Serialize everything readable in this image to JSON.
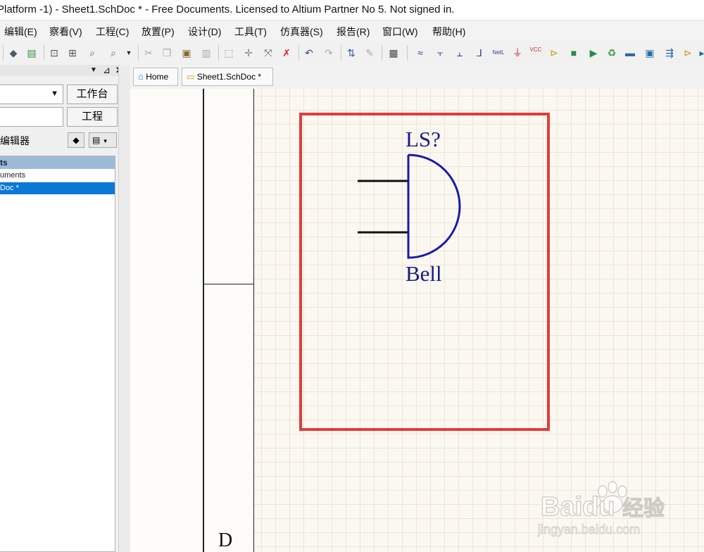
{
  "window": {
    "title": "Platform -1) - Sheet1.SchDoc * - Free Documents. Licensed to Altium Partner No 5. Not signed in."
  },
  "menubar": {
    "items": [
      "编辑(E)",
      "察看(V)",
      "工程(C)",
      "放置(P)",
      "设计(D)",
      "工具(T)",
      "仿真器(S)",
      "报告(R)",
      "窗口(W)",
      "帮助(H)"
    ]
  },
  "toolbar": {
    "icons": [
      "layers-icon",
      "library-icon",
      "zoom-fit-icon",
      "zoom-area-icon",
      "zoom-select-icon",
      "zoom-menu-icon",
      "cut-icon",
      "copy-icon",
      "paste-icon",
      "rubber-stamp-icon",
      "select-rect-icon",
      "move-icon",
      "drag-icon",
      "deselect-icon",
      "undo-icon",
      "redo-icon",
      "cross-probe-icon",
      "pencil-icon",
      "browse-library-icon",
      "wire-icon",
      "bus-icon",
      "bus-entry-icon",
      "signal-harness-icon",
      "net-label-icon",
      "gnd-port-icon",
      "vcc-port-icon",
      "place-part-icon",
      "sheet-symbol-icon",
      "sheet-entry-icon",
      "device-sheet-icon",
      "port-icon",
      "harness-connector-icon",
      "harness-entry-icon",
      "off-sheet-icon"
    ],
    "vcc_label": "VCC",
    "net_label": "NetL"
  },
  "panel": {
    "workbench_button": "工作台",
    "project_button": "工程",
    "editor_label": "编辑器",
    "tree_header": "ts",
    "tree_row_documents": "uments",
    "tree_row_selected": "Doc *"
  },
  "tabs": [
    {
      "label": "Home"
    },
    {
      "label": "Sheet1.SchDoc *"
    }
  ],
  "schematic": {
    "designator": "LS?",
    "comment": "Bell",
    "zone_letter": "D",
    "highlight_color": "#e03c3c",
    "symbol_color": "#1a1aa8"
  },
  "watermark": {
    "brand": "Baidu",
    "cn": "经验",
    "url": "jingyan.baidu.com"
  }
}
